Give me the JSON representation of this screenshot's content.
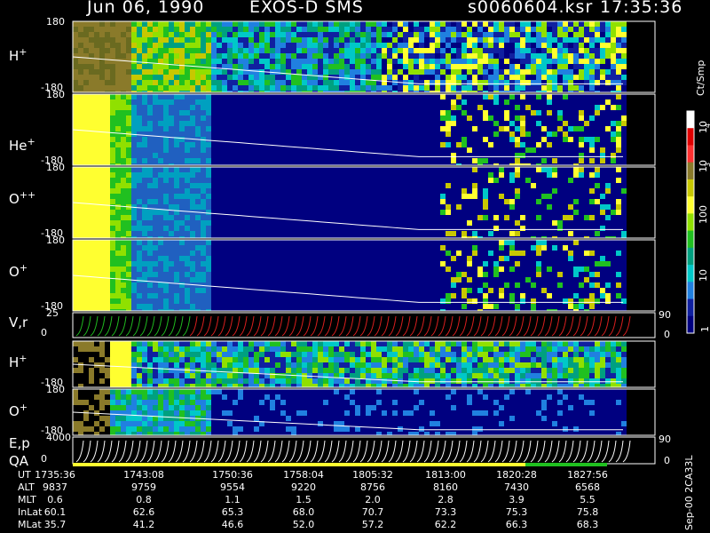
{
  "header": {
    "date": "Jun 06, 1990",
    "instrument": "EXOS-D SMS",
    "file": "s0060604.ksr",
    "time": "17:35:36"
  },
  "colorbar": {
    "unit": "Ct/Smp",
    "ticks": [
      "10",
      "4",
      "10",
      "3",
      "100",
      "10",
      "1"
    ],
    "colors": [
      "#ffffff",
      "#e00000",
      "#ff3030",
      "#8a7a2a",
      "#c8c800",
      "#ffff30",
      "#90e000",
      "#20c020",
      "#00a080",
      "#00c8c8",
      "#2080e0",
      "#1020a0",
      "#000080"
    ]
  },
  "footer_note": "Sep-00 2CA33L",
  "chart_data": {
    "type": "heatmap",
    "x_start": "1735:36",
    "x_end": "1832:00",
    "panels": [
      {
        "label_main": "H",
        "label_sup": "+",
        "ytop": "180",
        "ybot": "-180",
        "kind": "angle"
      },
      {
        "label_main": "He",
        "label_sup": "+",
        "ytop": "180",
        "ybot": "-180",
        "kind": "angle"
      },
      {
        "label_main": "O",
        "label_sup": "++",
        "ytop": "180",
        "ybot": "-180",
        "kind": "angle"
      },
      {
        "label_main": "O",
        "label_sup": "+",
        "ytop": "180",
        "ybot": "-180",
        "kind": "angle"
      },
      {
        "label_main": "V,r",
        "label_sup": "",
        "ytop": "25",
        "ybot": "0",
        "kind": "line",
        "right_top": "90",
        "right_bot": "0"
      },
      {
        "label_main": "H",
        "label_sup": "+",
        "ytop": "",
        "ybot": "-180",
        "kind": "angle"
      },
      {
        "label_main": "O",
        "label_sup": "+",
        "ytop": "180",
        "ybot": "-180",
        "kind": "angle"
      },
      {
        "label_main": "E,p",
        "label_sup": "",
        "ytop": "4000",
        "ybot": "0",
        "kind": "line",
        "right_top": "90",
        "right_bot": "0"
      }
    ],
    "qa_label": "QA",
    "time_table": {
      "rows": [
        {
          "label": "UT",
          "values": [
            "1735:36",
            "1743:08",
            "1750:36",
            "1758:04",
            "1805:32",
            "1813:00",
            "1820:28",
            "1827:56"
          ]
        },
        {
          "label": "ALT",
          "values": [
            "9837",
            "9759",
            "9554",
            "9220",
            "8756",
            "8160",
            "7430",
            "6568"
          ]
        },
        {
          "label": "MLT",
          "values": [
            "0.6",
            "0.8",
            "1.1",
            "1.5",
            "2.0",
            "2.8",
            "3.9",
            "5.5"
          ]
        },
        {
          "label": "InLat",
          "values": [
            "60.1",
            "62.6",
            "65.3",
            "68.0",
            "70.7",
            "73.3",
            "75.3",
            "75.8"
          ]
        },
        {
          "label": "MLat",
          "values": [
            "35.7",
            "41.2",
            "46.6",
            "52.0",
            "57.2",
            "62.2",
            "66.3",
            "68.3"
          ]
        }
      ]
    }
  }
}
